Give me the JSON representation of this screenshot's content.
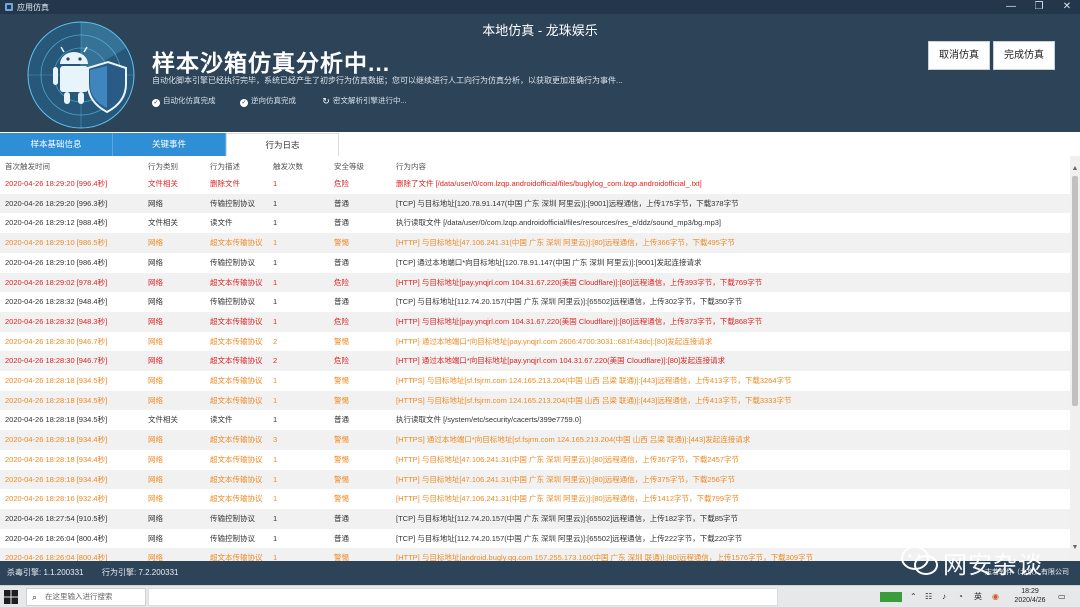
{
  "window": {
    "title": "应用仿真",
    "center_title": "本地仿真 - 龙珠娱乐",
    "controls": {
      "minimize": "—",
      "maximize": "❐",
      "close": "✕"
    }
  },
  "header": {
    "heading": "样本沙箱仿真分析中...",
    "description": "自动化脚本引擎已经执行完毕，系统已经产生了初步行为仿真数据；您可以继续进行人工向行为仿真分析，以获取更加准确行为事件...",
    "steps": [
      {
        "icon": "check-circle-icon",
        "label": "自动化仿真完成"
      },
      {
        "icon": "check-circle-icon",
        "label": "逆向仿真完成"
      },
      {
        "icon": "refresh-icon",
        "label": "密文解析引擎进行中..."
      }
    ],
    "buttons": {
      "cancel": "取消仿真",
      "finish": "完成仿真"
    }
  },
  "tabs": [
    {
      "label": "样本基础信息",
      "active": false
    },
    {
      "label": "关键事件",
      "active": false
    },
    {
      "label": "行为日志",
      "active": true
    }
  ],
  "table": {
    "columns": [
      "首次触发时间",
      "行为类别",
      "行为描述",
      "触发次数",
      "安全等级",
      "行为内容"
    ],
    "rows": [
      {
        "level": "danger",
        "cells": [
          "2020-04-26 18:29:20 [996.4秒]",
          "文件相关",
          "删除文件",
          "1",
          "危险",
          "删除了文件 [/data/user/0/com.lzqp.androidofficial/files/buglylog_com.lzqp.androidofficial_.txt]"
        ]
      },
      {
        "level": "normal",
        "cells": [
          "2020-04-26 18:29:20 [996.3秒]",
          "网络",
          "传输控制协议",
          "1",
          "普通",
          "[TCP] 与目标地址[120.78.91.147(中国 广东 深圳 阿里云)]:[9001]远程通信，上传175字节，下载378字节"
        ]
      },
      {
        "level": "normal",
        "cells": [
          "2020-04-26 18:29:12 [988.4秒]",
          "文件相关",
          "读文件",
          "1",
          "普通",
          "执行读取文件 [/data/user/0/com.lzqp.androidofficial/files/resources/res_e/ddz/sound_mp3/bg.mp3]"
        ]
      },
      {
        "level": "warn",
        "cells": [
          "2020-04-26 18:29:10 [986.5秒]",
          "网络",
          "超文本传输协议",
          "1",
          "警惕",
          "[HTTP] 与目标地址[47.106.241.31(中国 广东 深圳 阿里云)]:[80]远程通信，上传366字节，下载495字节"
        ]
      },
      {
        "level": "normal",
        "cells": [
          "2020-04-26 18:29:10 [986.4秒]",
          "网络",
          "传输控制协议",
          "1",
          "普通",
          "[TCP] 通过本地端口*向目标地址[120.78.91.147(中国 广东 深圳 阿里云)]:[9001]发起连接请求"
        ]
      },
      {
        "level": "danger",
        "cells": [
          "2020-04-26 18:29:02 [978.4秒]",
          "网络",
          "超文本传输协议",
          "1",
          "危险",
          "[HTTP] 与目标地址[pay.ynqjrl.com 104.31.67.220(美国 Cloudflare)]:[80]远程通信，上传393字节，下载769字节"
        ]
      },
      {
        "level": "normal",
        "cells": [
          "2020-04-26 18:28:32 [948.4秒]",
          "网络",
          "传输控制协议",
          "1",
          "普通",
          "[TCP] 与目标地址[112.74.20.157(中国 广东 深圳 阿里云)]:[65502]远程通信，上传302字节，下载350字节"
        ]
      },
      {
        "level": "danger",
        "cells": [
          "2020-04-26 18:28:32 [948.3秒]",
          "网络",
          "超文本传输协议",
          "1",
          "危险",
          "[HTTP] 与目标地址[pay.ynqjrl.com 104.31.67.220(美国 Cloudflare)]:[80]远程通信，上传373字节，下载868字节"
        ]
      },
      {
        "level": "warn",
        "cells": [
          "2020-04-26 18:28:30 [946.7秒]",
          "网络",
          "超文本传输协议",
          "2",
          "警惕",
          "[HTTP] 通过本地端口*向目标地址[pay.ynqjrl.com 2606:4700:3031::681f:43dc]:[80]发起连接请求"
        ]
      },
      {
        "level": "danger",
        "cells": [
          "2020-04-26 18:28:30 [946.7秒]",
          "网络",
          "超文本传输协议",
          "2",
          "危险",
          "[HTTP] 通过本地端口*向目标地址[pay.ynqjrl.com 104.31.67.220(美国 Cloudflare)]:[80]发起连接请求"
        ]
      },
      {
        "level": "warn",
        "cells": [
          "2020-04-26 18:28:18 [934.5秒]",
          "网络",
          "超文本传输协议",
          "1",
          "警惕",
          "[HTTPS] 与目标地址[sf.fsjrm.com 124.165.213.204(中国 山西 吕梁 联通)]:[443]远程通信，上传413字节，下载3264字节"
        ]
      },
      {
        "level": "warn",
        "cells": [
          "2020-04-26 18:28:18 [934.5秒]",
          "网络",
          "超文本传输协议",
          "1",
          "警惕",
          "[HTTPS] 与目标地址[sf.fsjrm.com 124.165.213.204(中国 山西 吕梁 联通)]:[443]远程通信，上传413字节，下载3333字节"
        ]
      },
      {
        "level": "normal",
        "cells": [
          "2020-04-26 18:28:18 [934.5秒]",
          "文件相关",
          "读文件",
          "1",
          "普通",
          "执行读取文件 [/system/etc/security/cacerts/399e7759.0]"
        ]
      },
      {
        "level": "warn",
        "cells": [
          "2020-04-26 18:28:18 [934.4秒]",
          "网络",
          "超文本传输协议",
          "3",
          "警惕",
          "[HTTPS] 通过本地端口*向目标地址[sf.fsjrm.com 124.165.213.204(中国 山西 吕梁 联通)]:[443]发起连接请求"
        ]
      },
      {
        "level": "warn",
        "cells": [
          "2020-04-26 18:28:18 [934.4秒]",
          "网络",
          "超文本传输协议",
          "1",
          "警惕",
          "[HTTP] 与目标地址[47.106.241.31(中国 广东 深圳 阿里云)]:[80]远程通信，上传367字节，下载2457字节"
        ]
      },
      {
        "level": "warn",
        "cells": [
          "2020-04-26 18:28:18 [934.4秒]",
          "网络",
          "超文本传输协议",
          "1",
          "警惕",
          "[HTTP] 与目标地址[47.106.241.31(中国 广东 深圳 阿里云)]:[80]远程通信，上传375字节，下载256字节"
        ]
      },
      {
        "level": "warn",
        "cells": [
          "2020-04-26 18:28:16 [932.4秒]",
          "网络",
          "超文本传输协议",
          "1",
          "警惕",
          "[HTTP] 与目标地址[47.106.241.31(中国 广东 深圳 阿里云)]:[80]远程通信，上传1412字节，下载799字节"
        ]
      },
      {
        "level": "normal",
        "cells": [
          "2020-04-26 18:27:54 [910.5秒]",
          "网络",
          "传输控制协议",
          "1",
          "普通",
          "[TCP] 与目标地址[112.74.20.157(中国 广东 深圳 阿里云)]:[65502]远程通信，上传182字节，下载85字节"
        ]
      },
      {
        "level": "normal",
        "cells": [
          "2020-04-26 18:26:04 [800.4秒]",
          "网络",
          "传输控制协议",
          "1",
          "普通",
          "[TCP] 与目标地址[112.74.20.157(中国 广东 深圳 阿里云)]:[65502]远程通信，上传222字节，下载220字节"
        ]
      },
      {
        "level": "warn",
        "cells": [
          "2020-04-26 18:26:04 [800.4秒]",
          "网络",
          "超文本传输协议",
          "1",
          "警惕",
          "[HTTP] 与目标地址[android.bugly.qq.com 157.255.173.160(中国 广东 深圳 联通)]:[80]远程通信，上传1576字节，下载309字节"
        ]
      }
    ]
  },
  "statusbar": {
    "antivirus_engine": "杀毒引擎: 1.1.200331",
    "behavior_engine": "行为引擎: 7.2.200331",
    "company": "志若软件（北京）有限公司"
  },
  "taskbar": {
    "search_placeholder": "在这里输入进行搜索",
    "time": "18:29",
    "date": "2020/4/26"
  },
  "watermark": {
    "text": "网安杂谈"
  },
  "colors": {
    "header_bg": "#2c4358",
    "tab_blue": "#2f8fd6",
    "danger": "#e02424",
    "warn": "#f08a24"
  }
}
